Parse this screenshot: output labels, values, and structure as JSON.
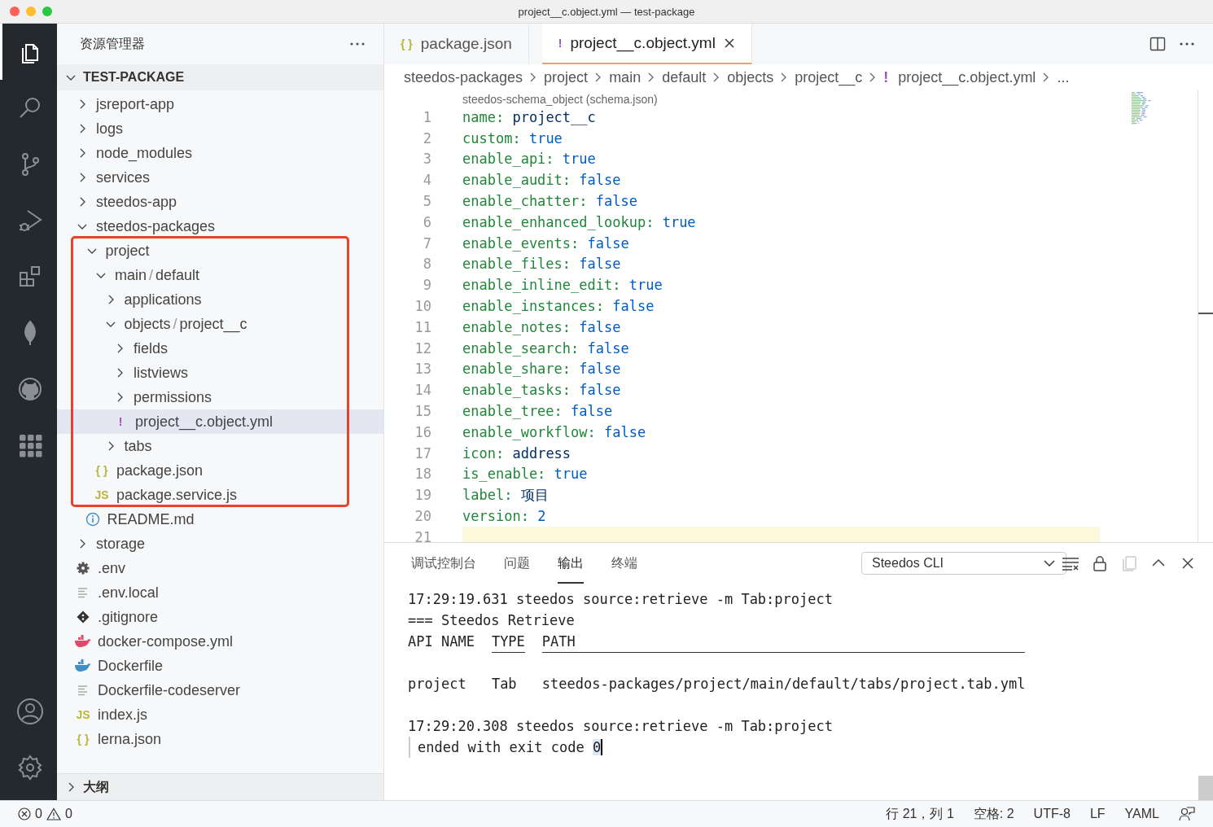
{
  "window": {
    "title": "project__c.object.yml — test-package"
  },
  "activity_bar": {
    "top": [
      {
        "kind": "explorer",
        "selected": true
      },
      {
        "kind": "search",
        "selected": false
      },
      {
        "kind": "source-control",
        "selected": false
      },
      {
        "kind": "run-debug",
        "selected": false
      },
      {
        "kind": "extensions",
        "selected": false
      },
      {
        "kind": "leaf",
        "selected": false
      },
      {
        "kind": "github",
        "selected": false
      },
      {
        "kind": "apps",
        "selected": false
      }
    ],
    "bottom": [
      {
        "kind": "account"
      },
      {
        "kind": "settings"
      }
    ]
  },
  "explorer": {
    "title": "资源管理器",
    "section": {
      "label": "TEST-PACKAGE",
      "expanded": true
    },
    "tree": [
      {
        "kind": "folder",
        "label": "jsreport-app",
        "expanded": false
      },
      {
        "kind": "folder",
        "label": "logs",
        "expanded": false
      },
      {
        "kind": "folder",
        "label": "node_modules",
        "expanded": false
      },
      {
        "kind": "folder",
        "label": "services",
        "expanded": false
      },
      {
        "kind": "folder",
        "label": "steedos-app",
        "expanded": false
      },
      {
        "kind": "folder",
        "label": "steedos-packages",
        "expanded": true,
        "children": [
          {
            "kind": "folder",
            "label": "project",
            "expanded": true,
            "highlighted": true,
            "children": [
              {
                "kind": "folder",
                "label": "main",
                "separator": "/",
                "label_2": "default",
                "expanded": true,
                "children": [
                  {
                    "kind": "folder",
                    "label": "applications",
                    "expanded": false
                  },
                  {
                    "kind": "folder",
                    "label": "objects",
                    "separator": "/",
                    "label_2": "project__c",
                    "expanded": true,
                    "children": [
                      {
                        "kind": "folder",
                        "label": "fields",
                        "expanded": false
                      },
                      {
                        "kind": "folder",
                        "label": "listviews",
                        "expanded": false
                      },
                      {
                        "kind": "folder",
                        "label": "permissions",
                        "expanded": false
                      },
                      {
                        "kind": "glyph",
                        "glyph": "!",
                        "color": "#9b4dca",
                        "label": "project__c.object.yml",
                        "selected": true
                      }
                    ]
                  },
                  {
                    "kind": "folder",
                    "label": "tabs",
                    "expanded": false
                  }
                ]
              },
              {
                "kind": "glyph",
                "glyph": "{ }",
                "color": "#b7b73b",
                "label": "package.json",
                "selected": false
              },
              {
                "kind": "glyph",
                "glyph": "JS",
                "color": "#b7b73b",
                "label": "package.service.js",
                "selected": false
              }
            ]
          },
          {
            "kind": "info",
            "label": "README.md",
            "selected": false
          }
        ]
      },
      {
        "kind": "folder",
        "label": "storage",
        "expanded": false
      },
      {
        "kind": "settings",
        "label": ".env",
        "selected": false
      },
      {
        "kind": "plain",
        "label": ".env.local",
        "selected": false
      },
      {
        "kind": "git",
        "label": ".gitignore",
        "selected": false
      },
      {
        "kind": "docker",
        "color": "#e8456b",
        "label": "docker-compose.yml",
        "selected": false
      },
      {
        "kind": "docker",
        "color": "#3f8fc4",
        "label": "Dockerfile",
        "selected": false
      },
      {
        "kind": "plain",
        "label": "Dockerfile-codeserver",
        "selected": false
      },
      {
        "kind": "glyph",
        "glyph": "JS",
        "color": "#b7b73b",
        "label": "index.js",
        "selected": false
      },
      {
        "kind": "glyph",
        "glyph": "{ }",
        "color": "#b7b73b",
        "label": "lerna.json",
        "selected": false
      }
    ],
    "outline": {
      "label": "大纲",
      "expanded": false
    }
  },
  "tabs": [
    {
      "glyph": "{ }",
      "color": "#b7b73b",
      "label": "package.json",
      "selected": false
    },
    {
      "glyph": "!",
      "color": "#9b4dca",
      "label": "project__c.object.yml",
      "selected": true
    }
  ],
  "breadcrumbs": [
    {
      "label": "steedos-packages"
    },
    {
      "label": "project"
    },
    {
      "label": "main"
    },
    {
      "label": "default"
    },
    {
      "label": "objects"
    },
    {
      "label": "project__c"
    },
    {
      "label": "project__c.object.yml",
      "glyph": "!"
    },
    {
      "label": "..."
    }
  ],
  "editor": {
    "schema_hint": "steedos-schema_object (schema.json)",
    "lines": [
      {
        "number": "1",
        "key": "name:",
        "value": "project__c",
        "color": "#032f62",
        "current": false
      },
      {
        "number": "2",
        "key": "custom:",
        "value": "true",
        "color": "#005cc5",
        "current": false
      },
      {
        "number": "3",
        "key": "enable_api:",
        "value": "true",
        "color": "#005cc5",
        "current": false
      },
      {
        "number": "4",
        "key": "enable_audit:",
        "value": "false",
        "color": "#005cc5",
        "current": false
      },
      {
        "number": "5",
        "key": "enable_chatter:",
        "value": "false",
        "color": "#005cc5",
        "current": false
      },
      {
        "number": "6",
        "key": "enable_enhanced_lookup:",
        "value": "true",
        "color": "#005cc5",
        "current": false
      },
      {
        "number": "7",
        "key": "enable_events:",
        "value": "false",
        "color": "#005cc5",
        "current": false
      },
      {
        "number": "8",
        "key": "enable_files:",
        "value": "false",
        "color": "#005cc5",
        "current": false
      },
      {
        "number": "9",
        "key": "enable_inline_edit:",
        "value": "true",
        "color": "#005cc5",
        "current": false
      },
      {
        "number": "10",
        "key": "enable_instances:",
        "value": "false",
        "color": "#005cc5",
        "current": false
      },
      {
        "number": "11",
        "key": "enable_notes:",
        "value": "false",
        "color": "#005cc5",
        "current": false
      },
      {
        "number": "12",
        "key": "enable_search:",
        "value": "false",
        "color": "#005cc5",
        "current": false
      },
      {
        "number": "13",
        "key": "enable_share:",
        "value": "false",
        "color": "#005cc5",
        "current": false
      },
      {
        "number": "14",
        "key": "enable_tasks:",
        "value": "false",
        "color": "#005cc5",
        "current": false
      },
      {
        "number": "15",
        "key": "enable_tree:",
        "value": "false",
        "color": "#005cc5",
        "current": false
      },
      {
        "number": "16",
        "key": "enable_workflow:",
        "value": "false",
        "color": "#005cc5",
        "current": false
      },
      {
        "number": "17",
        "key": "icon:",
        "value": "address",
        "color": "#032f62",
        "current": false
      },
      {
        "number": "18",
        "key": "is_enable:",
        "value": "true",
        "color": "#005cc5",
        "current": false
      },
      {
        "number": "19",
        "key": "label:",
        "value": "项目",
        "color": "#032f62",
        "current": false
      },
      {
        "number": "20",
        "key": "version:",
        "value": "2",
        "color": "#005cc5",
        "current": false
      },
      {
        "number": "21",
        "current": true
      }
    ]
  },
  "panel": {
    "tabs": [
      {
        "label": "调试控制台",
        "selected": false
      },
      {
        "label": "问题",
        "selected": false
      },
      {
        "label": "输出",
        "selected": true
      },
      {
        "label": "终端",
        "selected": false
      }
    ],
    "channel": {
      "value": "Steedos CLI"
    },
    "actions": [
      {
        "kind": "clear",
        "disabled": false
      },
      {
        "kind": "lock",
        "disabled": false
      },
      {
        "kind": "copy",
        "disabled": true
      },
      {
        "kind": "maximize",
        "disabled": false
      },
      {
        "kind": "close",
        "disabled": false
      }
    ],
    "output": [
      {
        "kind": "text",
        "text": "17:29:19.631 steedos source:retrieve -m Tab:project"
      },
      {
        "kind": "text",
        "text": "=== Steedos Retrieve"
      },
      {
        "kind": "table",
        "columns": [
          {
            "label": "API NAME",
            "rule": false
          },
          {
            "label": "TYPE",
            "rule": true
          },
          {
            "label": "PATH",
            "rule": true
          }
        ],
        "rows": [
          [
            "project",
            "Tab",
            "steedos-packages/project/main/default/tabs/project.tab.yml"
          ]
        ]
      },
      {
        "kind": "text",
        "text": "17:29:20.308 steedos source:retrieve -m Tab:project"
      },
      {
        "kind": "continued",
        "text": "ended with exit code ",
        "cursor_text": "0"
      }
    ]
  },
  "status_bar": {
    "errors": "0",
    "warnings": "0",
    "items": [
      "行 21，列 1",
      "空格: 2",
      "UTF-8",
      "LF",
      "YAML"
    ]
  }
}
